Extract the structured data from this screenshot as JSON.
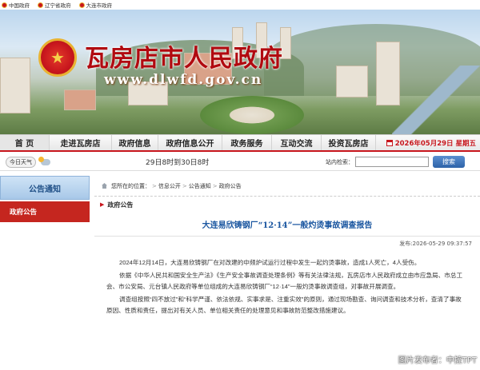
{
  "topstrip": {
    "links": [
      "中国政府",
      "辽宁省政府",
      "大连市政府"
    ]
  },
  "banner": {
    "title": "瓦房店市人民政府",
    "url": "www.dlwfd.gov.cn"
  },
  "nav": {
    "items": [
      "首 页",
      "走进瓦房店",
      "政府信息",
      "政府信息公开",
      "政务服务",
      "互动交流",
      "投资瓦房店"
    ],
    "date": "2026年05月29日 星期五"
  },
  "weather": {
    "tag": "今日天气",
    "text": "29日8时到30日8时"
  },
  "search": {
    "label": "站内检索：",
    "placeholder": "",
    "button": "搜索"
  },
  "sidebar": {
    "heading": "公告通知",
    "items": [
      "政府公告"
    ]
  },
  "breadcrumb": {
    "prefix": "您所在的位置：",
    "items": [
      "信息公开",
      "公告通知",
      "政府公告"
    ]
  },
  "section": {
    "title": "政府公告"
  },
  "article": {
    "title": "大连易欣铸钢厂“12·14”一般灼烫事故调查报告",
    "published": "发布:2026-05-29 09:37:57",
    "paragraphs": [
      "2024年12月14日，大连易欣铸钢厂在对改建的中频炉试运行过程中发生一起灼烫事故，造成1人死亡，4人受伤。",
      "依据《中华人民共和国安全生产法》《生产安全事故调查处理条例》等有关法律法规，瓦房店市人民政府成立由市应急局、市总工会、市公安局、元台镇人民政府等单位组成的大连易欣铸钢厂“12·14”一般灼烫事故调查组，对事故开展调查。",
      "调查组按照“四不放过”和“科学严谨、依法依规、实事求是、注重实效”的原则，通过现场勘查、询问调查和技术分析，查清了事故原因、性质和责任，提出对有关人员、单位相关责任的处理意见和事故防范整改措施建议。"
    ]
  },
  "watermark": "图片发布者：中控TPT",
  "colors": {
    "brand_red": "#c8161d",
    "link_blue": "#1a56a0",
    "sidebar_head": "#a8c8e8"
  }
}
